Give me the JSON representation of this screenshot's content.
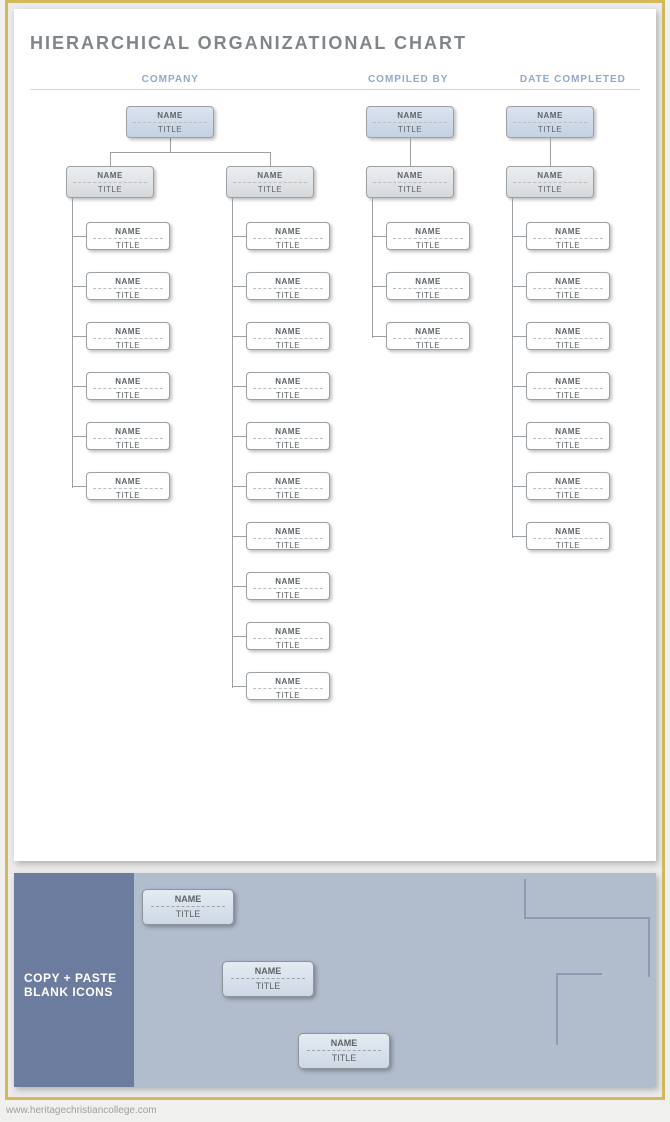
{
  "page": {
    "title": "HIERARCHICAL ORGANIZATIONAL CHART",
    "headers": {
      "company": "COMPANY",
      "compiled_by": "COMPILED BY",
      "date_completed": "DATE COMPLETED"
    }
  },
  "placeholder": {
    "name": "NAME",
    "title": "TITLE"
  },
  "chart_data": {
    "type": "hierarchy",
    "branches": [
      {
        "id": "company",
        "top": {
          "name": "NAME",
          "title": "TITLE",
          "style": "top-blue"
        },
        "subs": [
          {
            "name": "NAME",
            "title": "TITLE",
            "style": "sub-gray",
            "leaves": [
              {
                "name": "NAME",
                "title": "TITLE"
              },
              {
                "name": "NAME",
                "title": "TITLE"
              },
              {
                "name": "NAME",
                "title": "TITLE"
              },
              {
                "name": "NAME",
                "title": "TITLE"
              },
              {
                "name": "NAME",
                "title": "TITLE"
              },
              {
                "name": "NAME",
                "title": "TITLE"
              }
            ]
          },
          {
            "name": "NAME",
            "title": "TITLE",
            "style": "sub-gray",
            "leaves": [
              {
                "name": "NAME",
                "title": "TITLE"
              },
              {
                "name": "NAME",
                "title": "TITLE"
              },
              {
                "name": "NAME",
                "title": "TITLE"
              },
              {
                "name": "NAME",
                "title": "TITLE"
              },
              {
                "name": "NAME",
                "title": "TITLE"
              },
              {
                "name": "NAME",
                "title": "TITLE"
              },
              {
                "name": "NAME",
                "title": "TITLE"
              },
              {
                "name": "NAME",
                "title": "TITLE"
              },
              {
                "name": "NAME",
                "title": "TITLE"
              },
              {
                "name": "NAME",
                "title": "TITLE"
              }
            ]
          }
        ]
      },
      {
        "id": "compiled_by",
        "top": {
          "name": "NAME",
          "title": "TITLE",
          "style": "top-blue"
        },
        "subs": [
          {
            "name": "NAME",
            "title": "TITLE",
            "style": "sub-gray",
            "leaves": [
              {
                "name": "NAME",
                "title": "TITLE"
              },
              {
                "name": "NAME",
                "title": "TITLE"
              },
              {
                "name": "NAME",
                "title": "TITLE"
              }
            ]
          }
        ]
      },
      {
        "id": "date_completed",
        "top": {
          "name": "NAME",
          "title": "TITLE",
          "style": "top-blue"
        },
        "subs": [
          {
            "name": "NAME",
            "title": "TITLE",
            "style": "sub-gray",
            "leaves": [
              {
                "name": "NAME",
                "title": "TITLE"
              },
              {
                "name": "NAME",
                "title": "TITLE"
              },
              {
                "name": "NAME",
                "title": "TITLE"
              },
              {
                "name": "NAME",
                "title": "TITLE"
              },
              {
                "name": "NAME",
                "title": "TITLE"
              },
              {
                "name": "NAME",
                "title": "TITLE"
              },
              {
                "name": "NAME",
                "title": "TITLE"
              }
            ]
          }
        ]
      }
    ]
  },
  "panel2": {
    "side_label_line1": "COPY + PASTE",
    "side_label_line2": "BLANK ICONS",
    "samples": [
      {
        "name": "NAME",
        "title": "TITLE"
      },
      {
        "name": "NAME",
        "title": "TITLE"
      },
      {
        "name": "NAME",
        "title": "TITLE"
      }
    ]
  },
  "watermark": "www.heritagechristiancollege.com"
}
